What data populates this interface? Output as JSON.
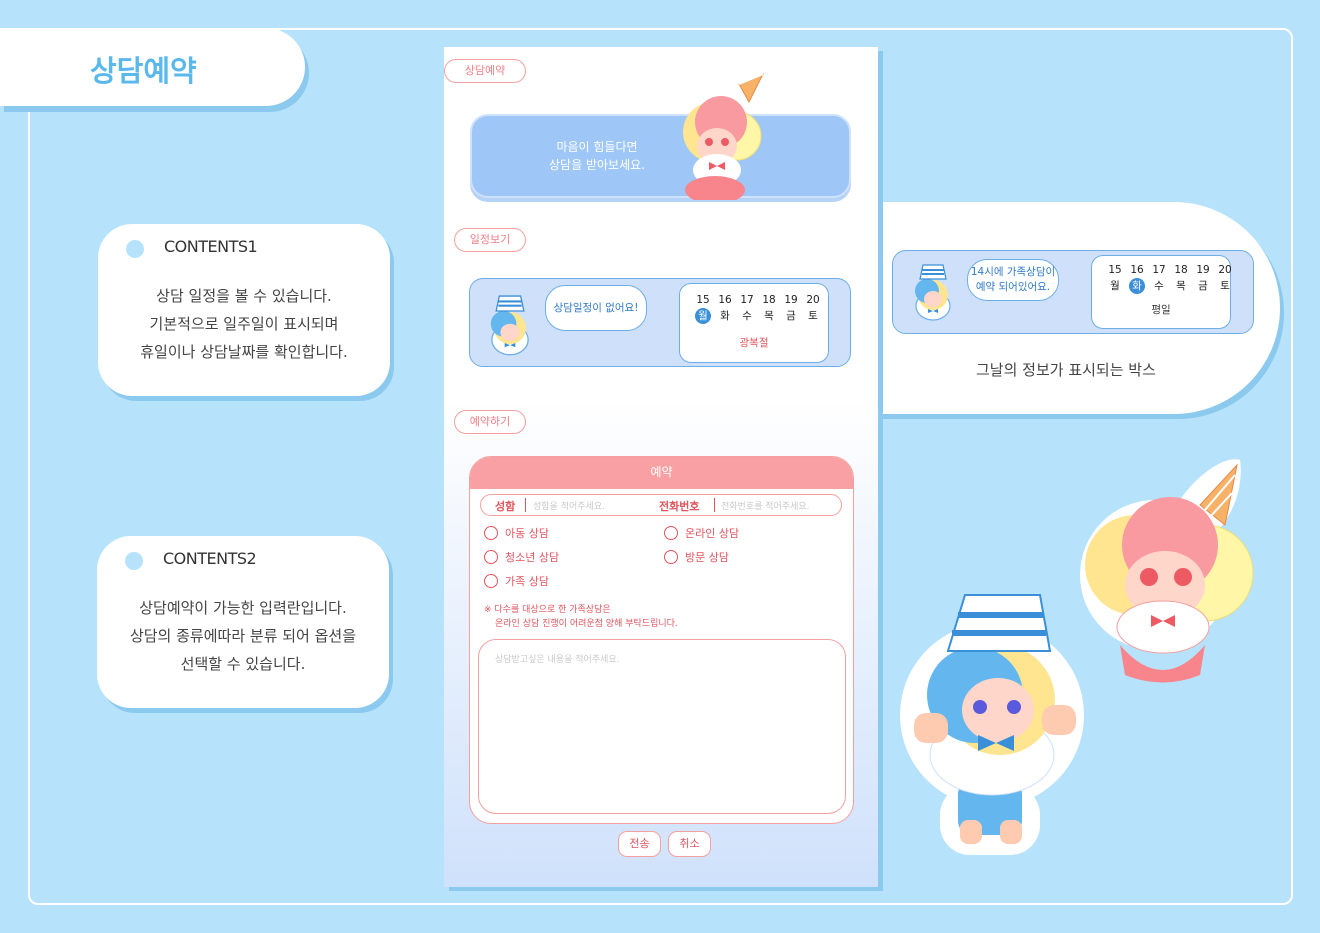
{
  "title": "상담예약",
  "contents": [
    {
      "head": "CONTENTS1",
      "lines": [
        "상담 일정을 볼 수 있습니다.",
        "기본적으로 일주일이 표시되며",
        "휴일이나 상담날짜를 확인합니다."
      ]
    },
    {
      "head": "CONTENTS2",
      "lines": [
        "상담예약이 가능한 입력란입니다.",
        "상담의 종류에따라 분류 되어 옵션을",
        "선택할 수 있습니다."
      ]
    }
  ],
  "phone": {
    "section1": "상담예약",
    "banner_lines": [
      "마음이 힘들다면",
      "상담을 받아보세요."
    ],
    "section2": "일정보기",
    "schedule": {
      "bubble": "상담일정이 없어요!",
      "dates": [
        "15",
        "16",
        "17",
        "18",
        "19",
        "20"
      ],
      "days": [
        "월",
        "화",
        "수",
        "목",
        "금",
        "토"
      ],
      "selected_index": 0,
      "note": "광복절"
    },
    "section3": "예약하기",
    "form": {
      "header": "예약",
      "name_label": "성함",
      "name_placeholder": "성함을 적어주세요.",
      "phone_label": "전화번호",
      "phone_placeholder": "전화번호를 적어주세요.",
      "options": [
        "아동 상담",
        "온라인 상담",
        "청소년 상담",
        "방문 상담",
        "가족 상담"
      ],
      "warning_lines": [
        "※ 다수를 대상으로 한 가족상담은",
        "온라인 상담 진행이 어려운점 양해 부탁드립니다."
      ],
      "textarea_placeholder": "상담받고싶은 내용을 적어주세요.",
      "submit": "전송",
      "cancel": "취소"
    }
  },
  "side": {
    "bubble_lines": [
      "14시에 가족상담이",
      "예약 되어있어요."
    ],
    "dates": [
      "15",
      "16",
      "17",
      "18",
      "19",
      "20"
    ],
    "days": [
      "월",
      "화",
      "수",
      "목",
      "금",
      "토"
    ],
    "selected_index": 1,
    "note": "평일",
    "caption": "그날의 정보가 표시되는 박스"
  },
  "colors": {
    "background": "#b6e3fb",
    "accent_blue": "#5bb8ec",
    "accent_pink": "#f8a0a3",
    "text_pink": "#e0555e"
  }
}
